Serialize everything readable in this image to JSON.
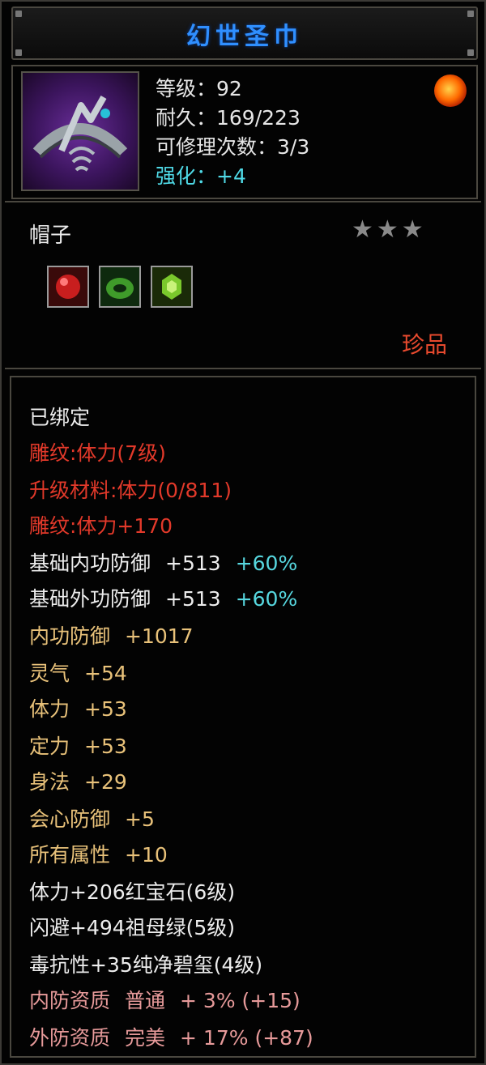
{
  "item": {
    "name": "幻世圣巾",
    "level": "等级：92",
    "durability": "耐久：169/223",
    "repair_count": "可修理次数：3/3",
    "enhance": "强化：+4",
    "type": "帽子",
    "star_rating": {
      "filled": 0,
      "total": 3,
      "glyphs": "★★★"
    },
    "rarity": "珍品",
    "gems": [
      {
        "icon": "red-gem-icon",
        "color": "#c81e1e"
      },
      {
        "icon": "green-jade-icon",
        "color": "#3f9b2a"
      },
      {
        "icon": "green-emerald-icon",
        "color": "#7ac82c"
      }
    ]
  },
  "attributes": {
    "bound": "已绑定",
    "carve_level": "雕纹:体力(7级)",
    "upgrade_material": "升级材料:体力(0/811)",
    "carve_bonus": "雕纹:体力+170",
    "base_inner_def": {
      "label": "基础内功防御",
      "value": "+513",
      "pct": "+60%"
    },
    "base_outer_def": {
      "label": "基础外功防御",
      "value": "+513",
      "pct": "+60%"
    },
    "inner_def": {
      "label": "内功防御",
      "value": "+1017"
    },
    "lingqi": {
      "label": "灵气",
      "value": "+54"
    },
    "tili": {
      "label": "体力",
      "value": "+53"
    },
    "dingli": {
      "label": "定力",
      "value": "+53"
    },
    "shenfa": {
      "label": "身法",
      "value": "+29"
    },
    "crit_def": {
      "label": "会心防御",
      "value": "+5"
    },
    "all_attr": {
      "label": "所有属性",
      "value": "+10"
    },
    "gem1": "体力+206红宝石(6级)",
    "gem2": "闪避+494祖母绿(5级)",
    "gem3": "毒抗性+35纯净碧玺(4级)",
    "inner_quality": {
      "label": "内防资质",
      "grade": "普通",
      "value": "+ 3% (+15)"
    },
    "outer_quality": {
      "label": "外防资质",
      "grade": "完美",
      "value": "+ 17% (+87)"
    }
  },
  "colors": {
    "title": "#2f8fff",
    "enhance": "#4fd9e6",
    "red_text": "#e2392a",
    "gold_text": "#e9c27a",
    "pink_text": "#e79a9a",
    "percent": "#57d8e0",
    "rarity": "#e84a2e"
  }
}
